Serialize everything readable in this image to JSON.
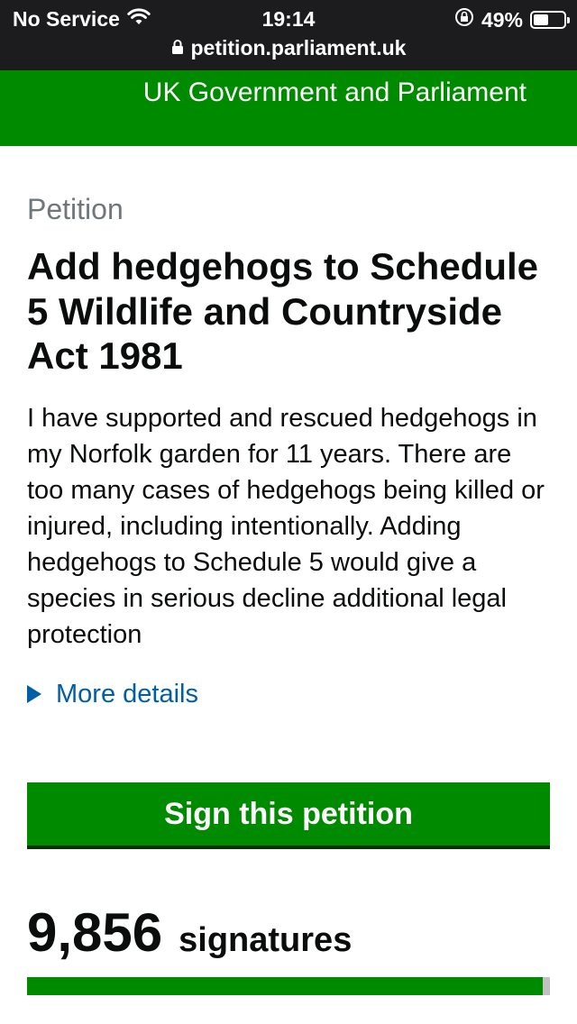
{
  "status_bar": {
    "carrier": "No Service",
    "time": "19:14",
    "battery": "49%",
    "battery_level": 0.49,
    "url": "petition.parliament.uk"
  },
  "header": {
    "title": "UK Government and Parliament"
  },
  "petition": {
    "caption": "Petition",
    "title": "Add hedgehogs to Schedule 5 Wildlife and Countryside Act 1981",
    "body": "I have supported and rescued hedgehogs in my Norfolk garden for 11 years. There are too many cases of hedgehogs being killed or injured, including intentionally. Adding hedgehogs to Schedule 5 would give a species in serious decline additional legal protection",
    "more_details": "More details",
    "sign_label": "Sign this petition"
  },
  "signatures": {
    "count": "9,856",
    "label": "signatures",
    "progress": 0.9856
  },
  "colors": {
    "brand_green": "#008a00",
    "link_blue": "#005ea5",
    "caption_grey": "#6f777b"
  }
}
